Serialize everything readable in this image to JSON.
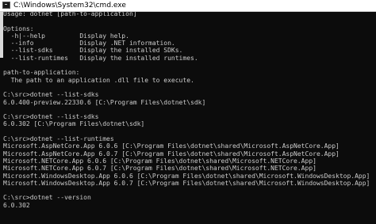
{
  "window": {
    "title": "C:\\Windows\\System32\\cmd.exe",
    "app_icon": "console-icon"
  },
  "console": {
    "lines": [
      "Usage: dotnet [path-to-application]",
      "",
      "Options:",
      "  -h|--help         Display help.",
      "  --info            Display .NET information.",
      "  --list-sdks       Display the installed SDKs.",
      "  --list-runtimes   Display the installed runtimes.",
      "",
      "path-to-application:",
      "  The path to an application .dll file to execute.",
      "",
      "C:\\src>dotnet --list-sdks",
      "6.0.400-preview.22330.6 [C:\\Program Files\\dotnet\\sdk]",
      "",
      "C:\\src>dotnet --list-sdks",
      "6.0.302 [C:\\Program Files\\dotnet\\sdk]",
      "",
      "C:\\src>dotnet --list-runtimes",
      "Microsoft.AspNetCore.App 6.0.6 [C:\\Program Files\\dotnet\\shared\\Microsoft.AspNetCore.App]",
      "Microsoft.AspNetCore.App 6.0.7 [C:\\Program Files\\dotnet\\shared\\Microsoft.AspNetCore.App]",
      "Microsoft.NETCore.App 6.0.6 [C:\\Program Files\\dotnet\\shared\\Microsoft.NETCore.App]",
      "Microsoft.NETCore.App 6.0.7 [C:\\Program Files\\dotnet\\shared\\Microsoft.NETCore.App]",
      "Microsoft.WindowsDesktop.App 6.0.6 [C:\\Program Files\\dotnet\\shared\\Microsoft.WindowsDesktop.App]",
      "Microsoft.WindowsDesktop.App 6.0.7 [C:\\Program Files\\dotnet\\shared\\Microsoft.WindowsDesktop.App]",
      "",
      "C:\\src>dotnet --version",
      "6.0.302"
    ]
  },
  "colors": {
    "titlebar": "#ffffff",
    "console_bg": "#0c0c0c",
    "console_text": "#cccccc"
  }
}
